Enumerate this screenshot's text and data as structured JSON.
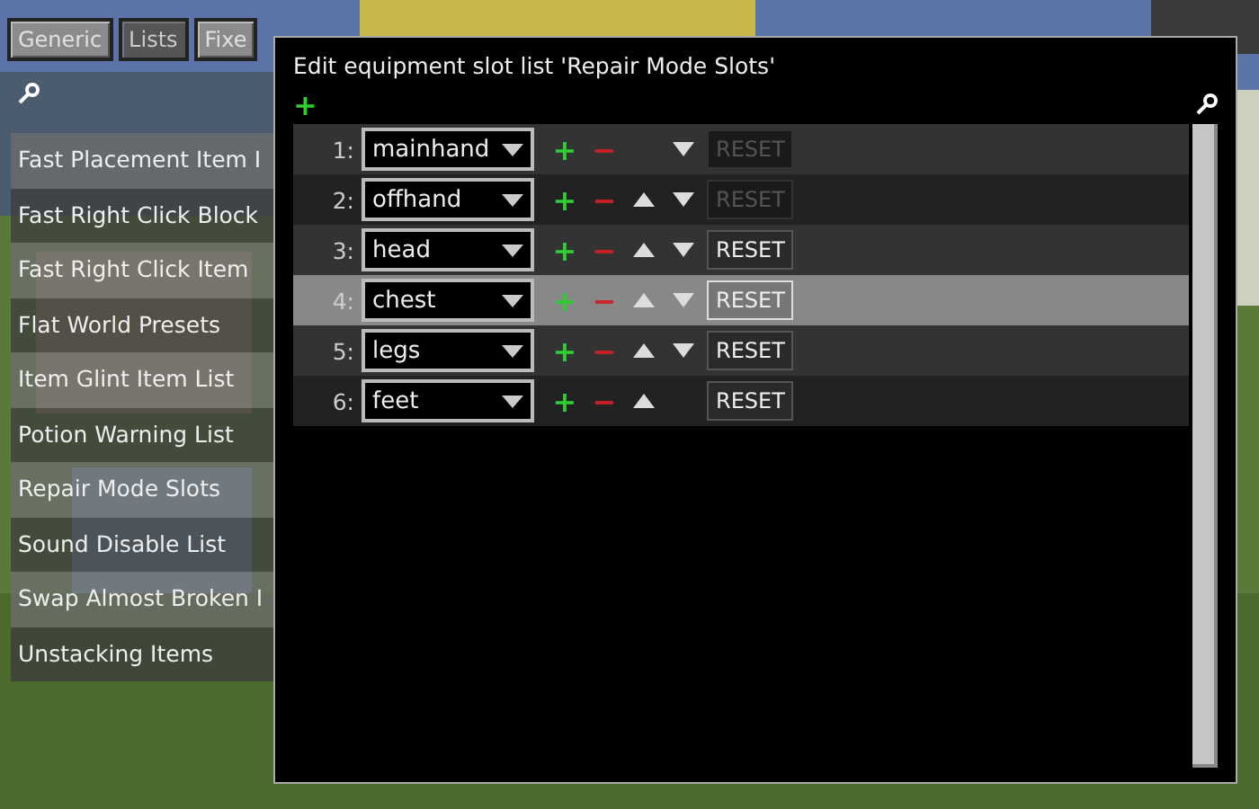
{
  "tabs": [
    {
      "label": "Generic",
      "selected": false
    },
    {
      "label": "Lists",
      "selected": true
    },
    {
      "label": "Fixe",
      "selected": false
    }
  ],
  "lists": [
    {
      "label": "Fast Placement Item I",
      "selected": false
    },
    {
      "label": "Fast Right Click Block",
      "selected": false
    },
    {
      "label": "Fast Right Click Item",
      "selected": false
    },
    {
      "label": "Flat World Presets",
      "selected": false
    },
    {
      "label": "Item Glint Item List",
      "selected": false
    },
    {
      "label": "Potion Warning List",
      "selected": false
    },
    {
      "label": "Repair Mode Slots",
      "selected": false
    },
    {
      "label": "Sound Disable List",
      "selected": false
    },
    {
      "label": "Swap Almost Broken I",
      "selected": false
    },
    {
      "label": "Unstacking Items",
      "selected": false
    }
  ],
  "dialog": {
    "title": "Edit equipment slot list 'Repair Mode Slots'",
    "add": "+",
    "rows": [
      {
        "index": "1:",
        "value": "mainhand",
        "add": "+",
        "remove": "−",
        "up": false,
        "down": true,
        "reset": "RESET",
        "reset_disabled": true,
        "selected": false
      },
      {
        "index": "2:",
        "value": "offhand",
        "add": "+",
        "remove": "−",
        "up": true,
        "down": true,
        "reset": "RESET",
        "reset_disabled": true,
        "selected": false
      },
      {
        "index": "3:",
        "value": "head",
        "add": "+",
        "remove": "−",
        "up": true,
        "down": true,
        "reset": "RESET",
        "reset_disabled": false,
        "selected": false
      },
      {
        "index": "4:",
        "value": "chest",
        "add": "+",
        "remove": "−",
        "up": true,
        "down": true,
        "reset": "RESET",
        "reset_disabled": false,
        "selected": true
      },
      {
        "index": "5:",
        "value": "legs",
        "add": "+",
        "remove": "−",
        "up": true,
        "down": true,
        "reset": "RESET",
        "reset_disabled": false,
        "selected": false
      },
      {
        "index": "6:",
        "value": "feet",
        "add": "+",
        "remove": "−",
        "up": true,
        "down": false,
        "reset": "RESET",
        "reset_disabled": false,
        "selected": false
      }
    ]
  }
}
